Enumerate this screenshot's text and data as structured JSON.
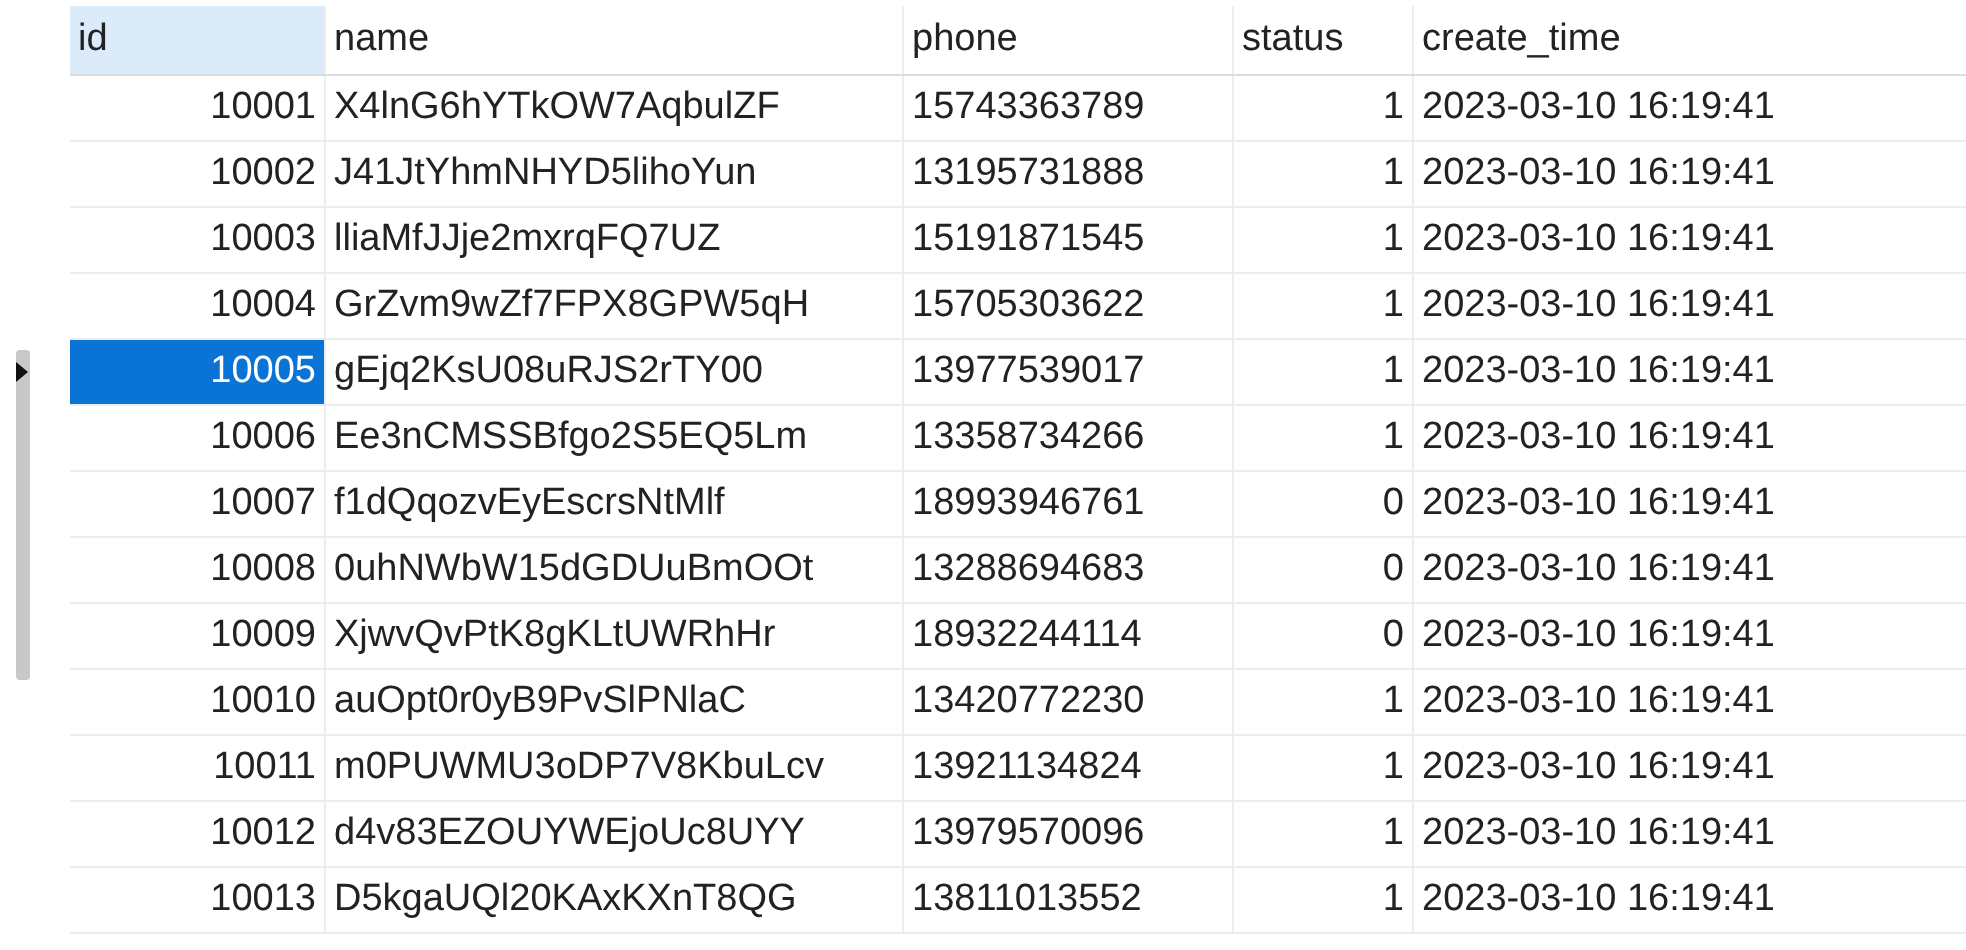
{
  "table": {
    "columns": [
      {
        "label": "id",
        "selected": true
      },
      {
        "label": "name",
        "selected": false
      },
      {
        "label": "phone",
        "selected": false
      },
      {
        "label": "status",
        "selected": false
      },
      {
        "label": "create_time",
        "selected": false
      }
    ],
    "rows": [
      {
        "id": "10001",
        "name": "X4lnG6hYTkOW7AqbulZF",
        "phone": "15743363789",
        "status": "1",
        "create_time": "2023-03-10 16:19:41",
        "selected": false
      },
      {
        "id": "10002",
        "name": "J41JtYhmNHYD5lihoYun",
        "phone": "13195731888",
        "status": "1",
        "create_time": "2023-03-10 16:19:41",
        "selected": false
      },
      {
        "id": "10003",
        "name": "lliaMfJJje2mxrqFQ7UZ",
        "phone": "15191871545",
        "status": "1",
        "create_time": "2023-03-10 16:19:41",
        "selected": false
      },
      {
        "id": "10004",
        "name": "GrZvm9wZf7FPX8GPW5qH",
        "phone": "15705303622",
        "status": "1",
        "create_time": "2023-03-10 16:19:41",
        "selected": false
      },
      {
        "id": "10005",
        "name": "gEjq2KsU08uRJS2rTY00",
        "phone": "13977539017",
        "status": "1",
        "create_time": "2023-03-10 16:19:41",
        "selected": true
      },
      {
        "id": "10006",
        "name": "Ee3nCMSSBfgo2S5EQ5Lm",
        "phone": "13358734266",
        "status": "1",
        "create_time": "2023-03-10 16:19:41",
        "selected": false
      },
      {
        "id": "10007",
        "name": "f1dQqozvEyEscrsNtMlf",
        "phone": "18993946761",
        "status": "0",
        "create_time": "2023-03-10 16:19:41",
        "selected": false
      },
      {
        "id": "10008",
        "name": "0uhNWbW15dGDUuBmOOt",
        "phone": "13288694683",
        "status": "0",
        "create_time": "2023-03-10 16:19:41",
        "selected": false
      },
      {
        "id": "10009",
        "name": "XjwvQvPtK8gKLtUWRhHr",
        "phone": "18932244114",
        "status": "0",
        "create_time": "2023-03-10 16:19:41",
        "selected": false
      },
      {
        "id": "10010",
        "name": "auOpt0r0yB9PvSlPNlaC",
        "phone": "13420772230",
        "status": "1",
        "create_time": "2023-03-10 16:19:41",
        "selected": false
      },
      {
        "id": "10011",
        "name": "m0PUWMU3oDP7V8KbuLcv",
        "phone": "13921134824",
        "status": "1",
        "create_time": "2023-03-10 16:19:41",
        "selected": false
      },
      {
        "id": "10012",
        "name": "d4v83EZOUYWEjoUc8UYY",
        "phone": "13979570096",
        "status": "1",
        "create_time": "2023-03-10 16:19:41",
        "selected": false
      },
      {
        "id": "10013",
        "name": "D5kgaUQl20KAxKXnT8QG",
        "phone": "13811013552",
        "status": "1",
        "create_time": "2023-03-10 16:19:41",
        "selected": false
      }
    ]
  }
}
